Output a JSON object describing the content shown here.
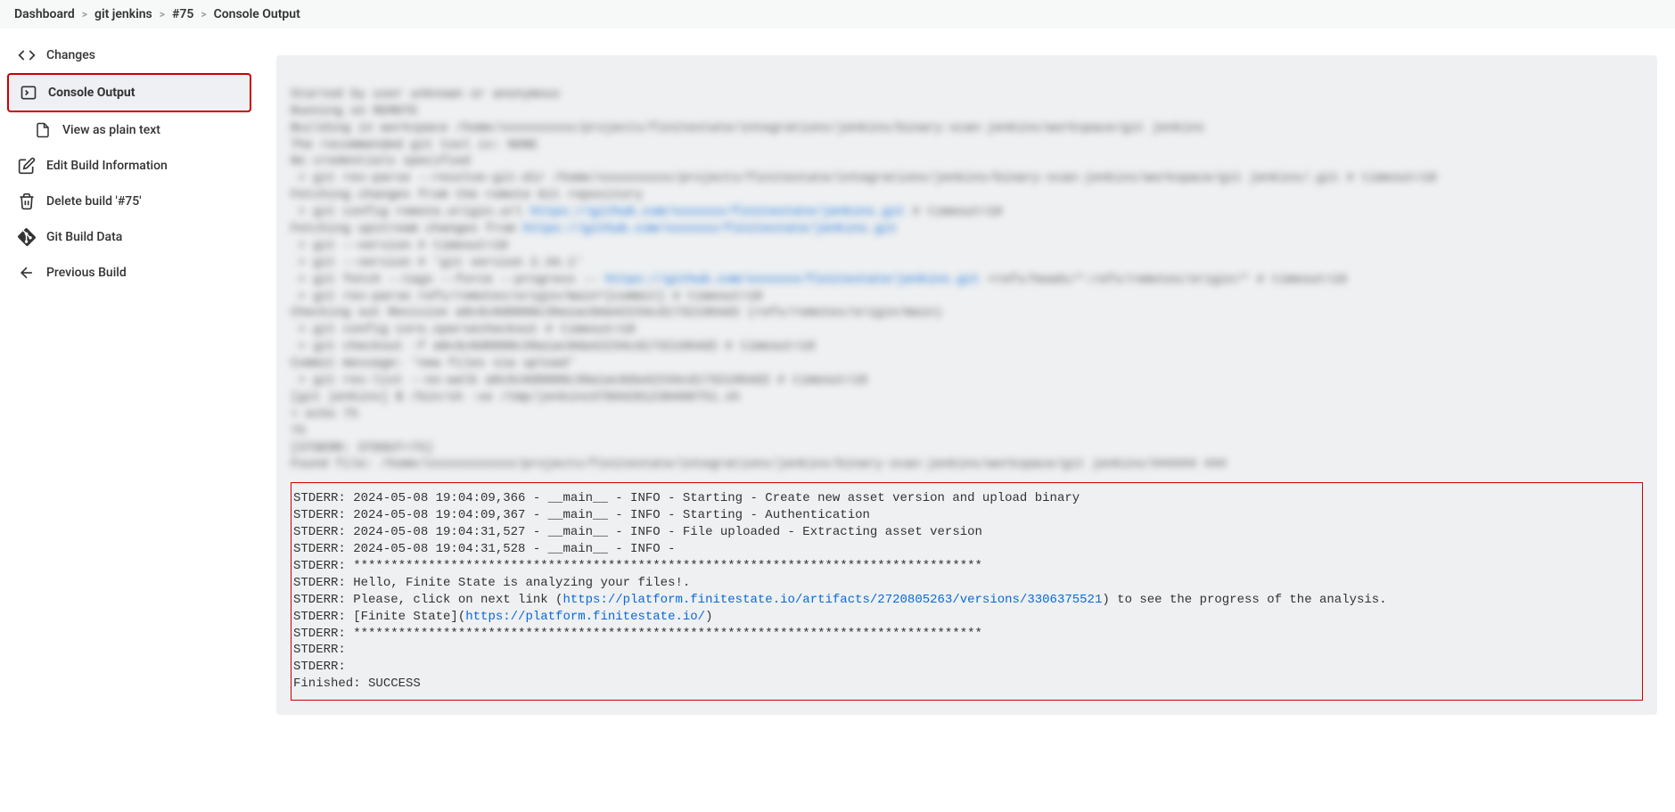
{
  "breadcrumb": [
    "Dashboard",
    "git jenkins",
    "#75",
    "Console Output"
  ],
  "sidebar": {
    "changes": "Changes",
    "console_output": "Console Output",
    "view_plain": "View as plain text",
    "edit_build": "Edit Build Information",
    "delete_build": "Delete build '#75'",
    "git_data": "Git Build Data",
    "prev_build": "Previous Build"
  },
  "blurred": {
    "l1": "Started by user unknown or anonymous",
    "l2": "Running on REMOTE",
    "l3": "Building in workspace /home/xxxxxxxxxx/projects/finitestate/integrations/jenkins/binary-scan-jenkins/workspace/git jenkins",
    "l4": "The recommended git tool is: NONE",
    "l5": "No credentials specified",
    "l6": " > git rev-parse --resolve-git-dir /home/xxxxxxxxxx/projects/finitestate/integrations/jenkins/binary-scan-jenkins/workspace/git jenkins/.git # timeout=10",
    "l7": "Fetching changes from the remote Git repository",
    "l8a": " > git config remote.origin.url ",
    "l8link": "https://github.com/xxxxxxx/finitestate/jenkins.git",
    "l8b": " # timeout=10",
    "l9": "Fetching upstream changes from ",
    "l9link": "https://github.com/xxxxxxx/finitestate/jenkins.git",
    "l10": " > git --version # timeout=10",
    "l11": " > git --version # 'git version 2.34.1'",
    "l12a": " > git fetch --tags --force --progress -- ",
    "l12link": "https://github.com/xxxxxxx/finitestate/jenkins.git",
    "l12b": " +refs/heads/*:refs/remotes/origin/* # timeout=10",
    "l13": " > git rev-parse refs/remotes/origin/main^{commit} # timeout=10",
    "l14": "Checking out Revision a0c6c0d0800c39a1ac0da42234cd17321964d2 (refs/remotes/origin/main)",
    "l15": " > git config core.sparsecheckout # timeout=10",
    "l16": " > git checkout -f a0c6c0d0800c39a1ac0da42234cd17321964d2 # timeout=10",
    "l17": "Commit message: 'new files via upload'",
    "l18": " > git rev-list --no-walk a0c6c0d0800c39a1ac0da42234cd17321964d2 # timeout=10",
    "l19": "[git jenkins] $ /bin/sh -xe /tmp/jenkins37894201230498751.sh",
    "l20": "+ echo 75",
    "l21": "75",
    "l22": "[STDERR: STDOUT=75]",
    "l23": "Found file: /home/xxxxxxxxxxxx/projects/finitestate/integrations/jenkins/binary-scan-jenkins/workspace/git jenkins/###### ###"
  },
  "output": {
    "l1": "STDERR: 2024-05-08 19:04:09,366 - __main__ - INFO - Starting - Create new asset version and upload binary",
    "l2": "STDERR: 2024-05-08 19:04:09,367 - __main__ - INFO - Starting - Authentication",
    "l3": "STDERR: 2024-05-08 19:04:31,527 - __main__ - INFO - File uploaded - Extracting asset version",
    "l4": "STDERR: 2024-05-08 19:04:31,528 - __main__ - INFO -",
    "l5": "STDERR: ************************************************************************************",
    "l6": "STDERR: Hello, Finite State is analyzing your files!.",
    "l7a": "STDERR: Please, click on next link (",
    "l7link": "https://platform.finitestate.io/artifacts/2720805263/versions/3306375521",
    "l7b": ") to see the progress of the analysis.",
    "l8a": "STDERR: [Finite State](",
    "l8link": "https://platform.finitestate.io/",
    "l8b": ")",
    "l9": "STDERR: ************************************************************************************",
    "l10": "STDERR:",
    "l11": "STDERR:",
    "l12": "Finished: SUCCESS"
  }
}
